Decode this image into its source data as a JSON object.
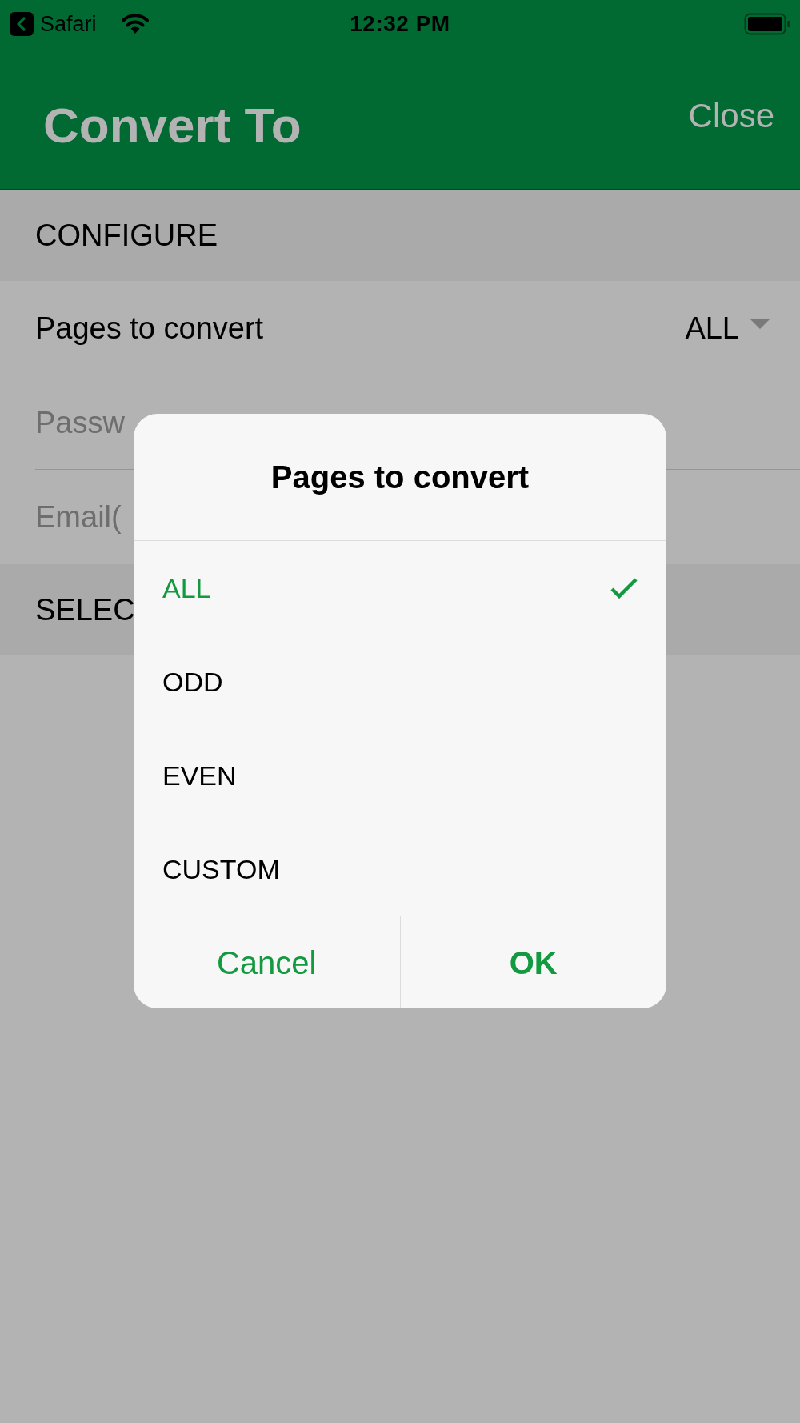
{
  "status_bar": {
    "back_label": "Safari",
    "time": "12:32 PM"
  },
  "header": {
    "title": "Convert To",
    "close": "Close"
  },
  "sections": [
    {
      "title": "CONFIGURE",
      "rows": [
        {
          "kind": "select",
          "label": "Pages to convert",
          "value": "ALL"
        },
        {
          "kind": "input",
          "placeholder": "Passw"
        },
        {
          "kind": "input",
          "placeholder": "Email("
        }
      ]
    },
    {
      "title": "SELEC"
    }
  ],
  "dialog": {
    "title": "Pages to convert",
    "options": [
      {
        "label": "ALL",
        "selected": true
      },
      {
        "label": "ODD",
        "selected": false
      },
      {
        "label": "EVEN",
        "selected": false
      },
      {
        "label": "CUSTOM",
        "selected": false
      }
    ],
    "buttons": [
      {
        "kind": "cancel",
        "label": "Cancel"
      },
      {
        "kind": "confirm",
        "label": "OK"
      }
    ]
  }
}
